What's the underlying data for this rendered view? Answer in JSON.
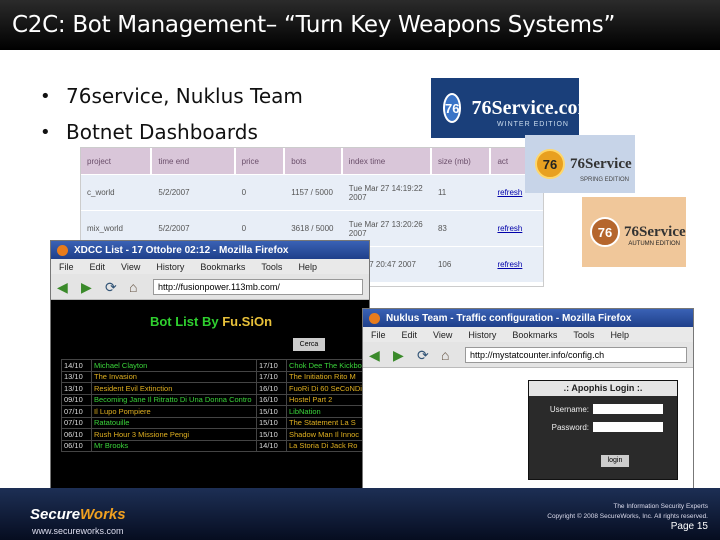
{
  "slide": {
    "title": "C2C: Bot Management– “Turn Key Weapons Systems”",
    "bullets": [
      "76service, Nuklus Team",
      "Botnet Dashboards"
    ]
  },
  "logos": [
    {
      "mark": "76",
      "name": "76Service.com",
      "edition": "WINTER EDITION"
    },
    {
      "mark": "76",
      "name": "76Service",
      "edition": "SPRING EDITION"
    },
    {
      "mark": "76",
      "name": "76Service",
      "edition": "AUTUMN EDITION"
    }
  ],
  "dashboard": {
    "columns": [
      "project",
      "time end",
      "price",
      "bots",
      "index time",
      "size (mb)",
      "act"
    ],
    "rows": [
      {
        "project": "c_world",
        "time_end": "5/2/2007",
        "price": "0",
        "bots": "1157 / 5000",
        "index_time": "Tue Mar 27 14:19:22 2007",
        "size": "11",
        "act": "refresh"
      },
      {
        "project": "mix_world",
        "time_end": "5/2/2007",
        "price": "0",
        "bots": "3618 / 5000",
        "index_time": "Tue Mar 27 13:20:26 2007",
        "size": "83",
        "act": "refresh"
      },
      {
        "project": "",
        "time_end": "",
        "price": "",
        "bots": "",
        "index_time": "Mar 27 20:47 2007",
        "size": "106",
        "act": "refresh"
      }
    ]
  },
  "xdcc_window": {
    "title": "XDCC List - 17 Ottobre 02:12 - Mozilla Firefox",
    "menu": [
      "File",
      "Edit",
      "View",
      "History",
      "Bookmarks",
      "Tools",
      "Help"
    ],
    "url": "http://fusionpower.113mb.com/",
    "heading_a": "Bot List By ",
    "heading_b": "Fu.SiOn",
    "search_button": "Cerca",
    "rows": [
      [
        "14/10",
        "Michael Clayton",
        "17/10",
        "Chok Dee The Kickbo"
      ],
      [
        "13/10",
        "The Invasion",
        "17/10",
        "The Initiation Rito M"
      ],
      [
        "13/10",
        "Resident Evil Extinction",
        "16/10",
        "FuoRi Di 60 SeCoNDi"
      ],
      [
        "09/10",
        "Becoming Jane Il Ritratto Di Una Donna Contro",
        "16/10",
        "Hostel Part 2"
      ],
      [
        "07/10",
        "Il Lupo Pompiere",
        "15/10",
        "LibNation"
      ],
      [
        "07/10",
        "Ratatouille",
        "15/10",
        "The Statement La S"
      ],
      [
        "06/10",
        "Rush Hour 3 Missione Pengi",
        "15/10",
        "Shadow Man Il Innoc"
      ],
      [
        "06/10",
        "Mr Brooks",
        "14/10",
        "La Storia Di Jack Ro"
      ]
    ]
  },
  "nuklus_window": {
    "title": "Nuklus Team - Traffic configuration - Mozilla Firefox",
    "menu": [
      "File",
      "Edit",
      "View",
      "History",
      "Bookmarks",
      "Tools",
      "Help"
    ],
    "url": "http://mystatcounter.info/config.ch",
    "login_title": ".: Apophis Login :.",
    "username_label": "Username:",
    "password_label": "Password:",
    "login_button": "login"
  },
  "footer": {
    "brand_a": "Secure",
    "brand_b": "Works",
    "site": "www.secureworks.com",
    "tagline": "The Information Security Experts",
    "copyright": "Copyright © 2008 SecureWorks, Inc. All rights reserved.",
    "page": "Page 15"
  }
}
